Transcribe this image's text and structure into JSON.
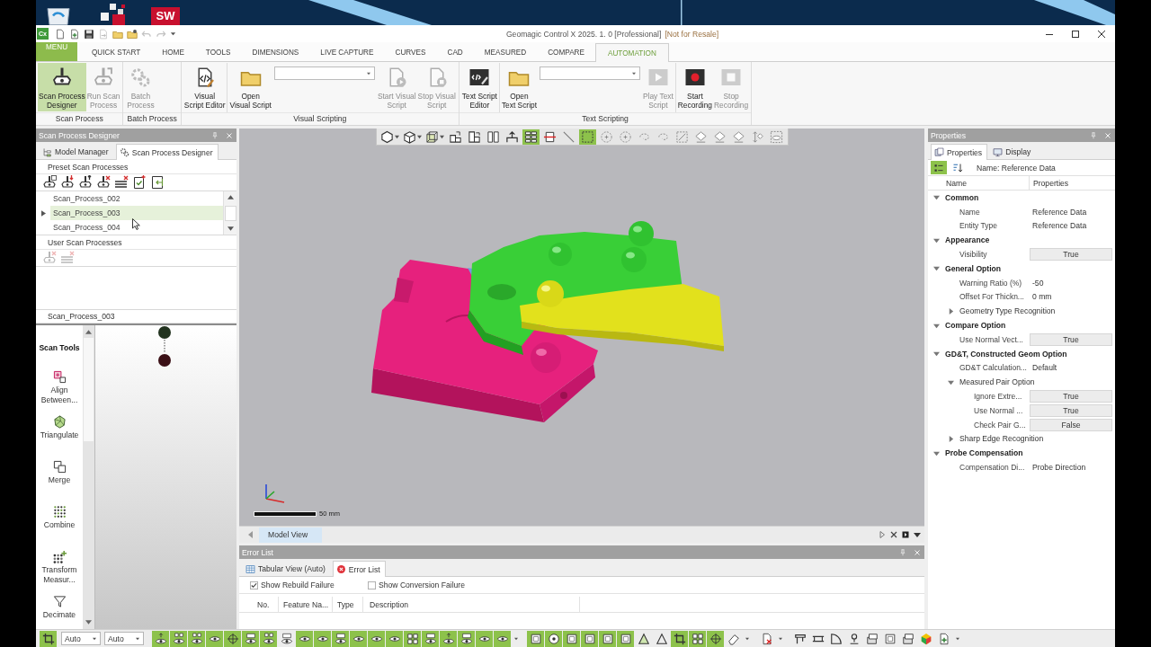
{
  "desktop": {
    "icons": [
      {
        "kind": "bin"
      },
      {
        "kind": "cubes"
      },
      {
        "kind": "logo",
        "text": "SW"
      }
    ]
  },
  "window": {
    "app_badge": "Cx",
    "title": "Geomagic Control X 2025. 1. 0 [Professional]",
    "title_note": "[Not for Resale]"
  },
  "quick_access": [
    {
      "kind": "new",
      "disabled": false
    },
    {
      "kind": "import",
      "disabled": false
    },
    {
      "kind": "save",
      "disabled": false
    },
    {
      "kind": "export",
      "disabled": true
    },
    {
      "kind": "open",
      "disabled": false
    },
    {
      "kind": "recent",
      "disabled": false
    },
    {
      "kind": "undo",
      "disabled": true
    },
    {
      "kind": "redo",
      "disabled": true
    },
    {
      "kind": "more",
      "disabled": false
    }
  ],
  "menu_tabs": [
    {
      "label": "MENU",
      "kind": "app",
      "selected": false
    },
    {
      "label": "QUICK START",
      "kind": "tab",
      "selected": false
    },
    {
      "label": "HOME",
      "kind": "tab",
      "selected": false
    },
    {
      "label": "TOOLS",
      "kind": "tab",
      "selected": false
    },
    {
      "label": "DIMENSIONS",
      "kind": "tab",
      "selected": false
    },
    {
      "label": "LIVE CAPTURE",
      "kind": "tab",
      "selected": false
    },
    {
      "label": "CURVES",
      "kind": "tab",
      "selected": false
    },
    {
      "label": "CAD",
      "kind": "tab",
      "selected": false
    },
    {
      "label": "MEASURED",
      "kind": "tab",
      "selected": false
    },
    {
      "label": "COMPARE",
      "kind": "tab",
      "selected": false
    },
    {
      "label": "AUTOMATION",
      "kind": "tab",
      "selected": true
    }
  ],
  "ribbon": {
    "groups": [
      {
        "label": "Scan Process",
        "sections": [
          {
            "items": [
              {
                "kind": "button",
                "label": "Scan Process\nDesigner",
                "active": true,
                "disabled": false
              },
              {
                "kind": "button",
                "label": "Run Scan\nProcess",
                "active": false,
                "disabled": true
              }
            ]
          }
        ]
      },
      {
        "label": "Batch Process",
        "sections": [
          {
            "items": [
              {
                "kind": "button",
                "label": "Batch\nProcess",
                "active": false,
                "disabled": true
              }
            ]
          }
        ]
      },
      {
        "label": "Visual Scripting",
        "sections": [
          {
            "items": [
              {
                "kind": "button",
                "label": "Visual\nScript Editor",
                "active": false,
                "disabled": false
              }
            ]
          },
          {
            "items": [
              {
                "kind": "button",
                "label": "Open\nVisual Script",
                "active": false,
                "disabled": false
              },
              {
                "kind": "dropdown"
              },
              {
                "kind": "button",
                "label": "Start Visual\nScript",
                "active": false,
                "disabled": true
              },
              {
                "kind": "button",
                "label": "Stop Visual\nScript",
                "active": false,
                "disabled": true
              }
            ]
          }
        ]
      },
      {
        "label": "Text Scripting",
        "sections": [
          {
            "items": [
              {
                "kind": "button",
                "label": "Text Script\nEditor",
                "active": false,
                "disabled": false
              }
            ]
          },
          {
            "items": [
              {
                "kind": "button",
                "label": "Open\nText Script",
                "active": false,
                "disabled": false
              },
              {
                "kind": "dropdown"
              },
              {
                "kind": "button",
                "label": "Play Text\nScript",
                "active": false,
                "disabled": true
              }
            ]
          },
          {
            "items": [
              {
                "kind": "button",
                "label": "Start\nRecording",
                "active": false,
                "disabled": false
              },
              {
                "kind": "button",
                "label": "Stop\nRecording",
                "active": false,
                "disabled": true
              }
            ]
          }
        ]
      }
    ]
  },
  "left_panel": {
    "title": "Scan Process Designer",
    "tabs": [
      {
        "label": "Model Manager",
        "selected": false
      },
      {
        "label": "Scan Process Designer",
        "selected": true
      }
    ],
    "preset_label": "Preset Scan Processes",
    "preset_tools": [
      {
        "disabled": false
      },
      {
        "disabled": false
      },
      {
        "disabled": false
      },
      {
        "disabled": false
      },
      {
        "disabled": false
      },
      {
        "disabled": false
      },
      {
        "disabled": false
      }
    ],
    "preset_list": [
      {
        "label": "Scan_Process_002",
        "selected": false
      },
      {
        "label": "Scan_Process_003",
        "selected": true
      },
      {
        "label": "Scan_Process_004",
        "selected": false
      }
    ],
    "user_label": "User Scan Processes",
    "user_tools": [
      {
        "disabled": true
      },
      {
        "disabled": true
      }
    ],
    "current_process": "Scan_Process_003",
    "scan_tools": {
      "title": "Scan Tools",
      "items": [
        {
          "label": "Align\nBetween..."
        },
        {
          "label": "Triangulate"
        },
        {
          "label": "Merge"
        },
        {
          "label": "Combine"
        },
        {
          "label": "Transform\nMeasur..."
        },
        {
          "label": "Decimate"
        }
      ]
    },
    "flow_nodes": [
      {
        "color": "#22331f"
      },
      {
        "color": "#3b1016"
      }
    ]
  },
  "viewport": {
    "toolbar": [
      {
        "kind": "split",
        "selected": false
      },
      {
        "kind": "split",
        "selected": false
      },
      {
        "kind": "split",
        "selected": false
      },
      {
        "kind": "button",
        "selected": false
      },
      {
        "kind": "button",
        "selected": false
      },
      {
        "kind": "button",
        "selected": false
      },
      {
        "kind": "button",
        "selected": false
      },
      {
        "kind": "button",
        "selected": true
      },
      {
        "kind": "button",
        "selected": false
      },
      {
        "kind": "button",
        "selected": false
      },
      {
        "kind": "button",
        "selected": true
      },
      {
        "kind": "button",
        "selected": false
      },
      {
        "kind": "button",
        "selected": false
      },
      {
        "kind": "button",
        "selected": false
      },
      {
        "kind": "button",
        "selected": false
      },
      {
        "kind": "button",
        "selected": false
      },
      {
        "kind": "button",
        "selected": false
      },
      {
        "kind": "button",
        "selected": false
      },
      {
        "kind": "button",
        "selected": false
      },
      {
        "kind": "button",
        "selected": false
      },
      {
        "kind": "button",
        "selected": false
      }
    ],
    "scale_label": "50 mm"
  },
  "view_tabs": [
    {
      "label": "Model View",
      "selected": true
    }
  ],
  "error_panel": {
    "title": "Error List",
    "tabs": [
      {
        "label": "Tabular View (Auto)",
        "selected": false
      },
      {
        "label": "Error List",
        "selected": true
      }
    ],
    "options": [
      {
        "label": "Show Rebuild Failure",
        "checked": true
      },
      {
        "label": "Show Conversion Failure",
        "checked": false
      }
    ],
    "columns": [
      "No.",
      "Feature Na...",
      "Type",
      "Description"
    ]
  },
  "properties": {
    "title": "Properties",
    "tabs": [
      {
        "label": "Properties",
        "selected": true
      },
      {
        "label": "Display",
        "selected": false
      }
    ],
    "view_modes": [
      {
        "selected": true
      },
      {
        "selected": false
      }
    ],
    "name_label": "Name: Reference Data",
    "columns": [
      "Name",
      "Properties"
    ],
    "tree": [
      {
        "kind": "category",
        "label": "Common",
        "expanded": true,
        "children": [
          {
            "kind": "text",
            "name": "Name",
            "value": "Reference Data"
          },
          {
            "kind": "text",
            "name": "Entity Type",
            "value": "Reference Data"
          }
        ]
      },
      {
        "kind": "category",
        "label": "Appearance",
        "expanded": true,
        "children": [
          {
            "kind": "choice",
            "name": "Visibility",
            "value": "True"
          }
        ]
      },
      {
        "kind": "category",
        "label": "General Option",
        "expanded": true,
        "children": [
          {
            "kind": "text",
            "name": "Warning Ratio (%)",
            "value": "-50"
          },
          {
            "kind": "text",
            "name": "Offset For Thickn...",
            "value": "0 mm"
          },
          {
            "kind": "group",
            "label": "Geometry Type Recognition",
            "expanded": false
          }
        ]
      },
      {
        "kind": "category",
        "label": "Compare Option",
        "expanded": true,
        "children": [
          {
            "kind": "choice",
            "name": "Use Normal Vect...",
            "value": "True"
          }
        ]
      },
      {
        "kind": "category",
        "label": "GD&T, Constructed Geom Option",
        "expanded": true,
        "children": [
          {
            "kind": "text",
            "name": "GD&T Calculation...",
            "value": "Default"
          },
          {
            "kind": "group",
            "label": "Measured Pair Option",
            "expanded": true,
            "children": [
              {
                "kind": "choice",
                "name": "Ignore Extre...",
                "value": "True"
              },
              {
                "kind": "choice",
                "name": "Use Normal ...",
                "value": "True"
              },
              {
                "kind": "choice",
                "name": "Check Pair G...",
                "value": "False"
              }
            ]
          },
          {
            "kind": "group",
            "label": "Sharp Edge Recognition",
            "expanded": false
          }
        ]
      },
      {
        "kind": "category",
        "label": "Probe Compensation",
        "expanded": true,
        "children": [
          {
            "kind": "text",
            "name": "Compensation Di...",
            "value": "Probe Direction"
          }
        ]
      }
    ]
  },
  "status_bar": {
    "lead_tool": {
      "on": true
    },
    "dropdowns": [
      {
        "value": "Auto"
      },
      {
        "value": "Auto"
      }
    ],
    "tool_groups": [
      {
        "tools": [
          {
            "on": true
          },
          {
            "on": true
          },
          {
            "on": true
          },
          {
            "on": true
          },
          {
            "on": true
          },
          {
            "on": true
          },
          {
            "on": true
          },
          {
            "on": false
          },
          {
            "on": true
          },
          {
            "on": true
          },
          {
            "on": true
          },
          {
            "on": true
          },
          {
            "on": true
          },
          {
            "on": true
          },
          {
            "on": true
          },
          {
            "on": true
          },
          {
            "on": true
          },
          {
            "on": true
          },
          {
            "on": true
          },
          {
            "on": true
          }
        ]
      },
      {
        "tools": [
          {
            "on": true
          },
          {
            "on": true
          },
          {
            "on": true
          },
          {
            "on": true
          },
          {
            "on": true
          },
          {
            "on": true
          },
          {
            "on": false
          },
          {
            "on": false
          },
          {
            "on": true
          },
          {
            "on": true
          },
          {
            "on": true
          },
          {
            "on": false
          }
        ]
      },
      {
        "tools": [
          {
            "on": false
          }
        ]
      },
      {
        "tools": [
          {
            "on": false
          },
          {
            "on": false
          },
          {
            "on": false
          },
          {
            "on": false
          },
          {
            "on": false
          },
          {
            "on": false
          },
          {
            "on": false
          },
          {
            "on": false
          },
          {
            "on": false
          }
        ]
      }
    ]
  }
}
